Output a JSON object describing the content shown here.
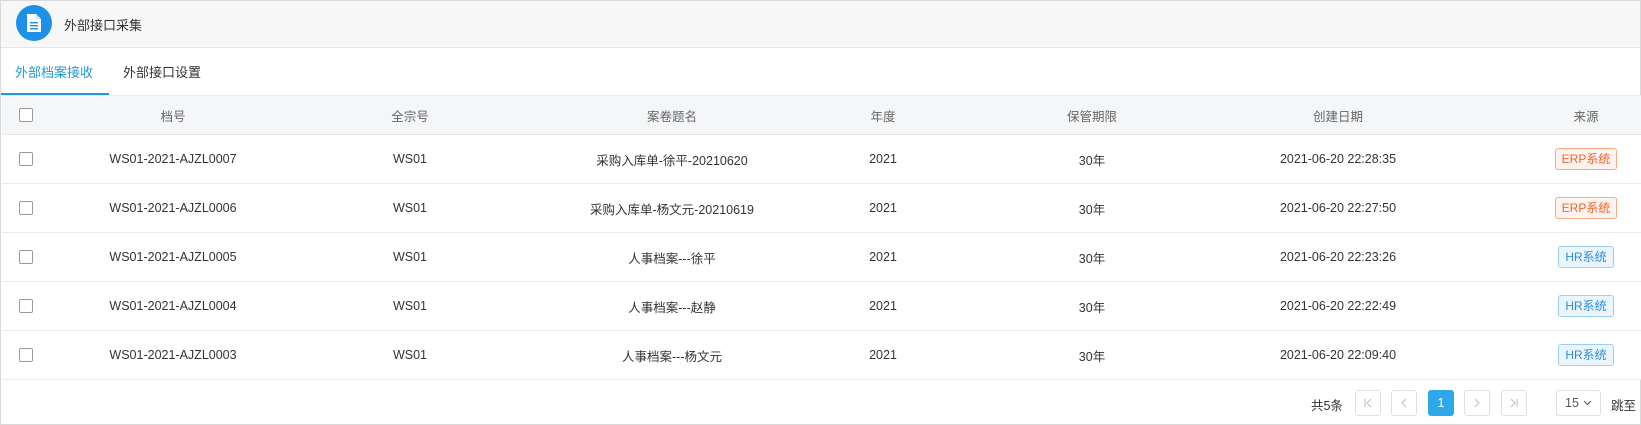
{
  "header": {
    "title": "外部接口采集"
  },
  "tabs": [
    {
      "label": "外部档案接收",
      "active": true
    },
    {
      "label": "外部接口设置",
      "active": false
    }
  ],
  "table": {
    "columns": [
      "档号",
      "全宗号",
      "案卷题名",
      "年度",
      "保管期限",
      "创建日期",
      "来源"
    ],
    "rows": [
      {
        "dh": "WS01-2021-AJZL0007",
        "qzh": "WS01",
        "title": "采购入库单-徐平-20210620",
        "year": "2021",
        "period": "30年",
        "date": "2021-06-20 22:28:35",
        "source": "ERP系统",
        "source_type": "erp"
      },
      {
        "dh": "WS01-2021-AJZL0006",
        "qzh": "WS01",
        "title": "采购入库单-杨文元-20210619",
        "year": "2021",
        "period": "30年",
        "date": "2021-06-20 22:27:50",
        "source": "ERP系统",
        "source_type": "erp"
      },
      {
        "dh": "WS01-2021-AJZL0005",
        "qzh": "WS01",
        "title": "人事档案---徐平",
        "year": "2021",
        "period": "30年",
        "date": "2021-06-20 22:23:26",
        "source": "HR系统",
        "source_type": "hr"
      },
      {
        "dh": "WS01-2021-AJZL0004",
        "qzh": "WS01",
        "title": "人事档案---赵静",
        "year": "2021",
        "period": "30年",
        "date": "2021-06-20 22:22:49",
        "source": "HR系统",
        "source_type": "hr"
      },
      {
        "dh": "WS01-2021-AJZL0003",
        "qzh": "WS01",
        "title": "人事档案---杨文元",
        "year": "2021",
        "period": "30年",
        "date": "2021-06-20 22:09:40",
        "source": "HR系统",
        "source_type": "hr"
      }
    ]
  },
  "pagination": {
    "total_label": "共5条",
    "current_page": "1",
    "page_size": "15",
    "jump_label": "跳至"
  },
  "colors": {
    "accent": "#1e9ad6",
    "erp": "#f0642f",
    "hr": "#2a8ed8"
  }
}
